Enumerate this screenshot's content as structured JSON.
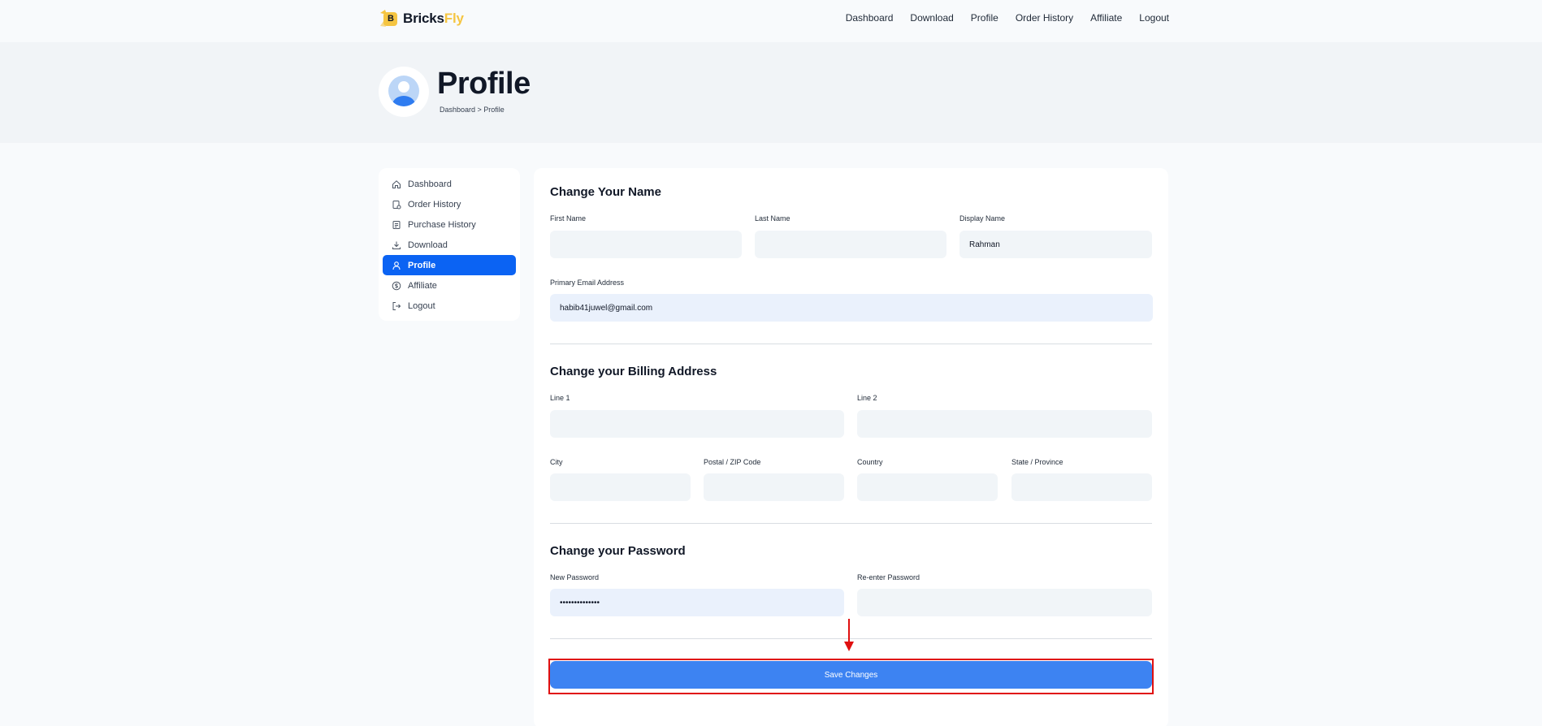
{
  "brand": {
    "name_part1": "Bricks",
    "name_part2": "Fly",
    "mark_letter": "B"
  },
  "nav": [
    "Dashboard",
    "Download",
    "Profile",
    "Order History",
    "Affiliate",
    "Logout"
  ],
  "header": {
    "title": "Profile",
    "breadcrumb": "Dashboard > Profile"
  },
  "sidebar": {
    "items": [
      {
        "label": "Dashboard",
        "icon": "home-icon"
      },
      {
        "label": "Order History",
        "icon": "receipt-icon"
      },
      {
        "label": "Purchase History",
        "icon": "document-icon"
      },
      {
        "label": "Download",
        "icon": "download-icon"
      },
      {
        "label": "Profile",
        "icon": "user-icon",
        "active": true
      },
      {
        "label": "Affiliate",
        "icon": "dollar-circle-icon"
      },
      {
        "label": "Logout",
        "icon": "logout-icon"
      }
    ]
  },
  "name_section": {
    "title": "Change Your Name",
    "first_name_label": "First Name",
    "first_name_value": "",
    "last_name_label": "Last Name",
    "last_name_value": "",
    "display_name_label": "Display Name",
    "display_name_value": "Rahman",
    "email_label": "Primary Email Address",
    "email_value": "habib41juwel@gmail.com"
  },
  "billing_section": {
    "title": "Change your Billing Address",
    "line1_label": "Line 1",
    "line2_label": "Line 2",
    "city_label": "City",
    "zip_label": "Postal / ZIP Code",
    "country_label": "Country",
    "state_label": "State / Province"
  },
  "password_section": {
    "title": "Change your Password",
    "new_label": "New Password",
    "new_value": "••••••••••••••",
    "reenter_label": "Re-enter Password",
    "reenter_value": ""
  },
  "save_button": {
    "label": "Save Changes"
  },
  "colors": {
    "accent": "#0b63f3",
    "button": "#3d83f2",
    "brand_yellow": "#f5c542",
    "annotation_red": "#e01010"
  }
}
